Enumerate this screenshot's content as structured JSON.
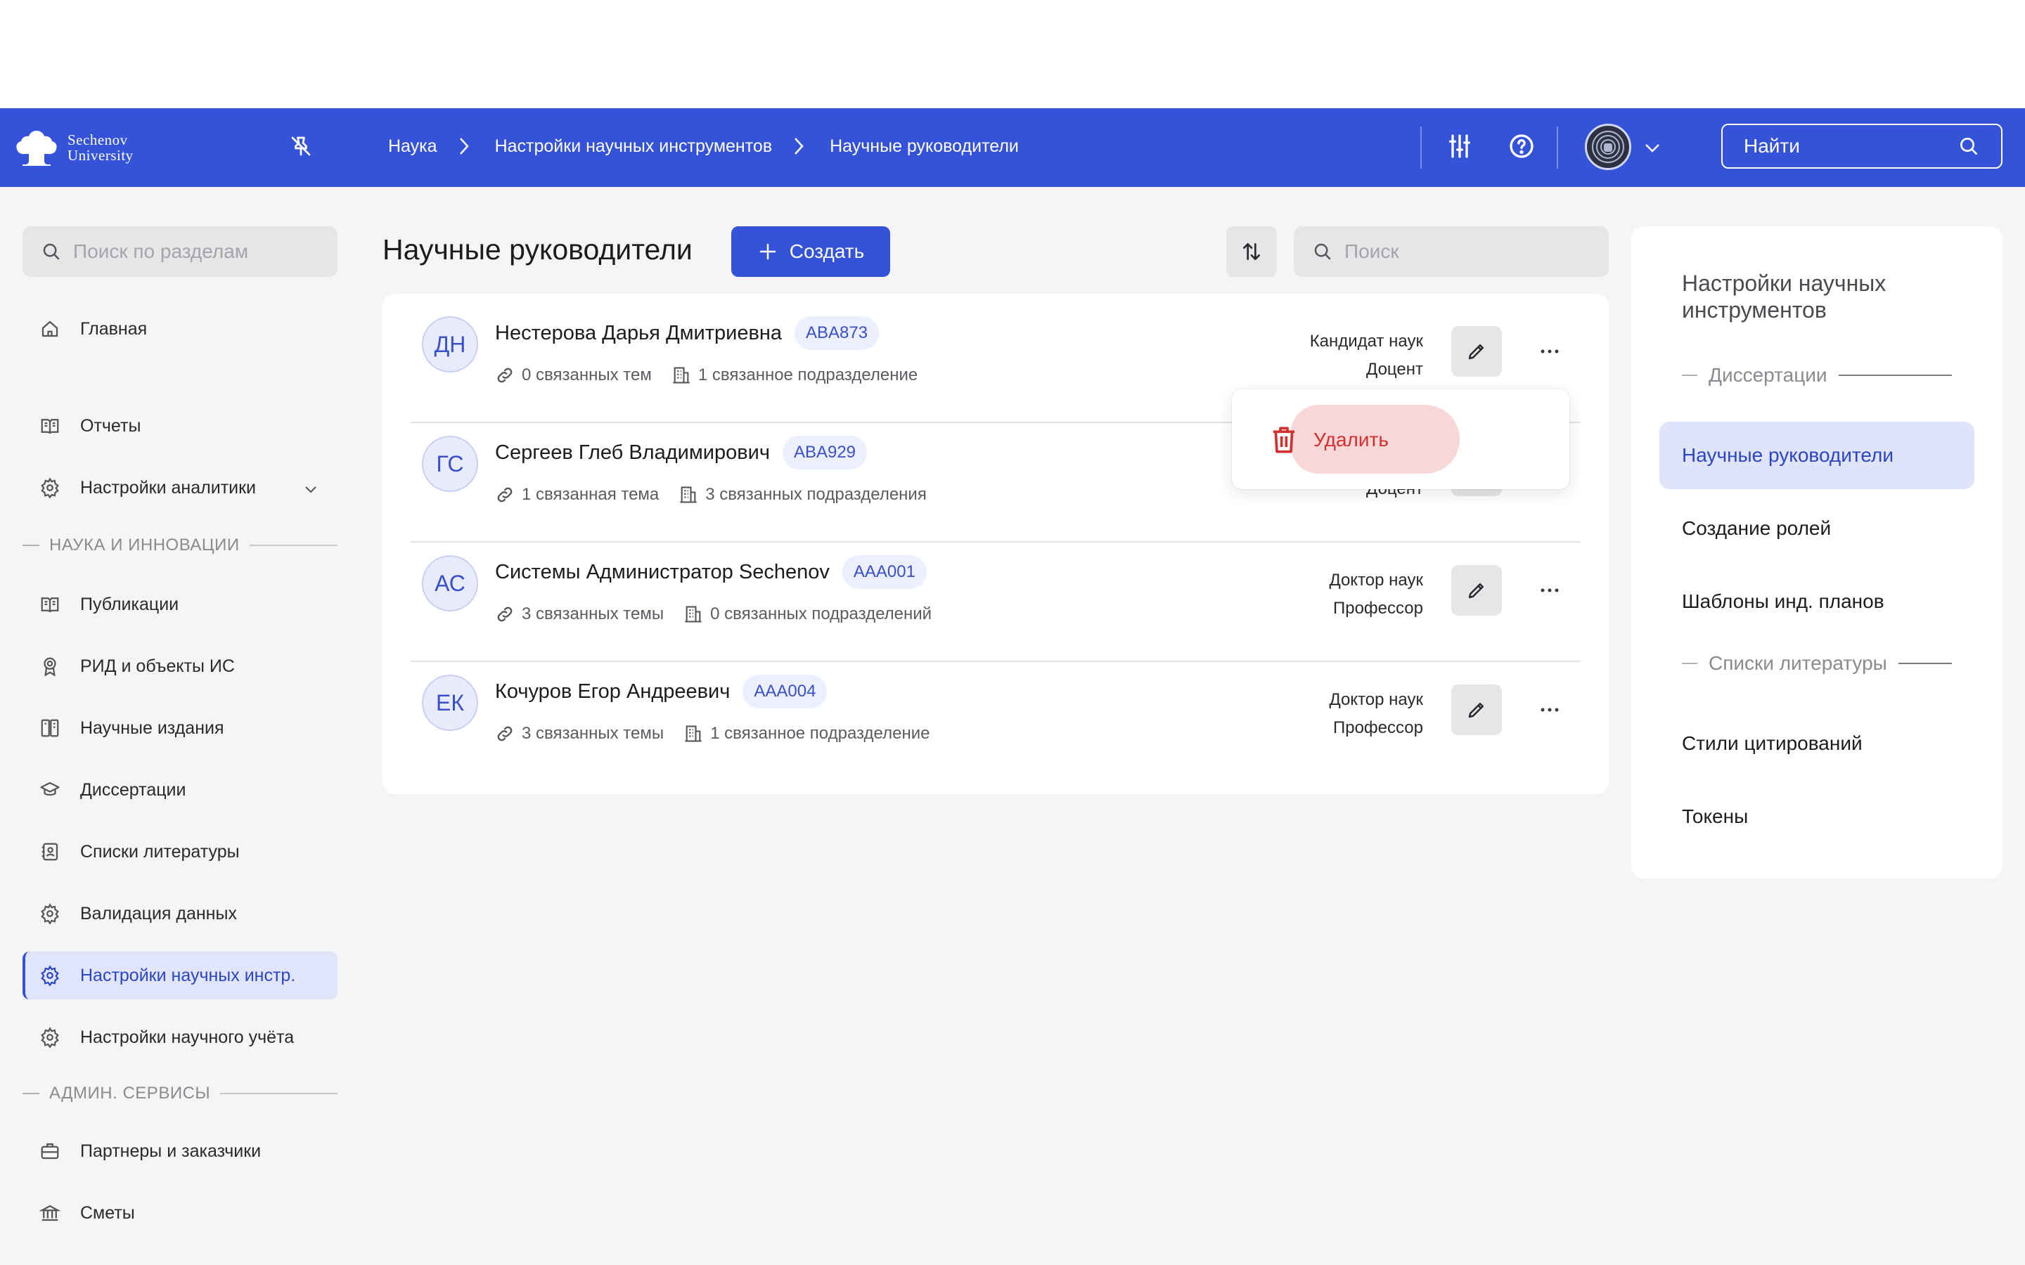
{
  "header": {
    "logo_line1": "Sechenov",
    "logo_line2": "University",
    "breadcrumb": [
      "Наука",
      "Настройки научных инструментов",
      "Научные руководители"
    ],
    "search_label": "Найти"
  },
  "sidebar": {
    "search_placeholder": "Поиск по разделам",
    "items": [
      {
        "label": "Главная",
        "icon": "home-icon"
      },
      {
        "label": "Отчеты",
        "icon": "book-icon"
      },
      {
        "label": "Настройки аналитики",
        "icon": "gear-icon"
      },
      {
        "label": "Публикации",
        "icon": "book-icon"
      },
      {
        "label": "РИД и объекты ИС",
        "icon": "award-icon"
      },
      {
        "label": "Научные издания",
        "icon": "journal-icon"
      },
      {
        "label": "Диссертации",
        "icon": "graduation-cap-icon"
      },
      {
        "label": "Списки литературы",
        "icon": "contacts-book-icon"
      },
      {
        "label": "Валидация данных",
        "icon": "gear-icon"
      },
      {
        "label": "Настройки научных инстр.",
        "icon": "gear-icon"
      },
      {
        "label": "Настройки научного учёта",
        "icon": "gear-icon"
      },
      {
        "label": "Партнеры и заказчики",
        "icon": "briefcase-icon"
      },
      {
        "label": "Сметы",
        "icon": "bank-icon"
      }
    ],
    "sections": [
      "НАУКА И ИННОВАЦИИ",
      "АДМИН. СЕРВИСЫ"
    ]
  },
  "main": {
    "title": "Научные руководители",
    "create_label": "Создать",
    "search_placeholder": "Поиск",
    "rows": [
      {
        "initials": "ДН",
        "name": "Нестерова Дарья Дмитриевна",
        "code": "ABA873",
        "topics": "0 связанных тем",
        "units": "1 связанное подразделение",
        "degree": "Кандидат наук",
        "title": "Доцент"
      },
      {
        "initials": "ГС",
        "name": "Сергеев Глеб Владимирович",
        "code": "ABA929",
        "topics": "1 связанная тема",
        "units": "3 связанных подразделения",
        "degree": "",
        "title": "Доцент"
      },
      {
        "initials": "АС",
        "name": "Системы Администратор Sechenov",
        "code": "AAA001",
        "topics": "3 связанных темы",
        "units": "0 связанных подразделений",
        "degree": "Доктор наук",
        "title": "Профессор"
      },
      {
        "initials": "ЕК",
        "name": "Кочуров Егор Андреевич",
        "code": "AAA004",
        "topics": "3 связанных темы",
        "units": "1 связанное подразделение",
        "degree": "Доктор наук",
        "title": "Профессор"
      }
    ],
    "dropdown": {
      "delete_label": "Удалить"
    }
  },
  "right_panel": {
    "title": "Настройки научных инструментов",
    "section1": "Диссертации",
    "items1": [
      "Научные руководители",
      "Создание ролей",
      "Шаблоны инд. планов"
    ],
    "section2": "Списки литературы",
    "items2": [
      "Стили цитирований",
      "Токены"
    ]
  },
  "colors": {
    "accent": "#3553d9",
    "active_bg": "#e1e5fb",
    "danger": "#d42f2f"
  }
}
